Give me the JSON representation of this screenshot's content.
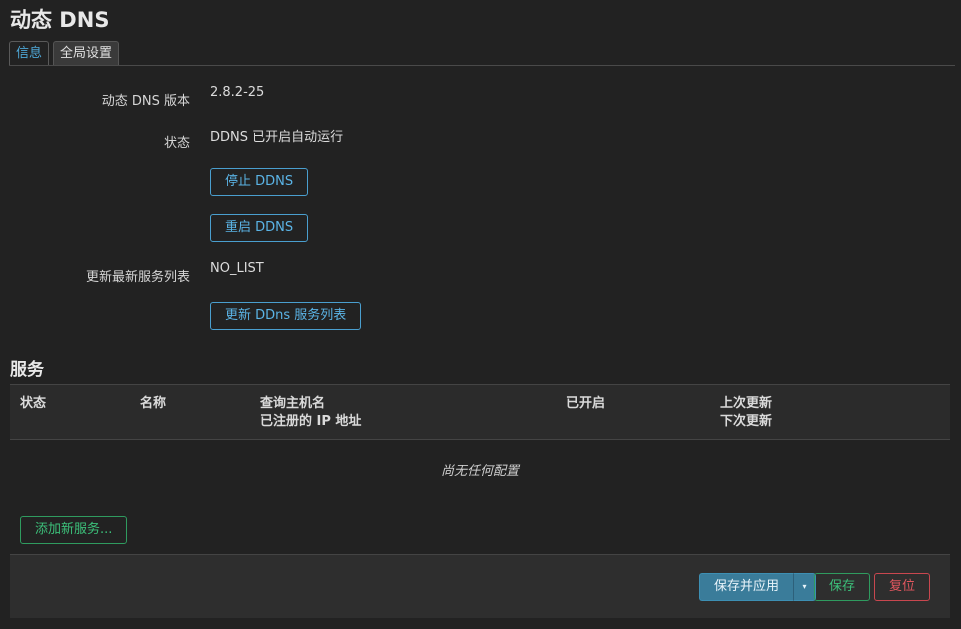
{
  "page": {
    "title": "动态 DNS"
  },
  "tabs": [
    {
      "label": "信息",
      "active": true
    },
    {
      "label": "全局设置",
      "active": false
    }
  ],
  "info": {
    "version_label": "动态 DNS 版本",
    "version_value": "2.8.2-25",
    "status_label": "状态",
    "status_value": "DDNS 已开启自动运行",
    "stop_button": "停止 DDNS",
    "restart_button": "重启 DDNS",
    "update_list_label": "更新最新服务列表",
    "update_list_value": "NO_LIST",
    "update_list_button": "更新 DDns 服务列表"
  },
  "services": {
    "title": "服务",
    "columns": {
      "status": "状态",
      "name": "名称",
      "lookup_host": "查询主机名",
      "registered_ip": "已注册的 IP 地址",
      "enabled": "已开启",
      "last_update": "上次更新",
      "next_update": "下次更新"
    },
    "empty_text": "尚无任何配置",
    "add_button": "添加新服务..."
  },
  "footer": {
    "save_apply": "保存并应用",
    "save": "保存",
    "reset": "复位"
  },
  "colors": {
    "background": "#222222",
    "accent_blue": "#4a9fcf",
    "accent_green": "#2f9b5f",
    "accent_red": "#c9474f",
    "apply_blue": "#3a7c9a"
  }
}
